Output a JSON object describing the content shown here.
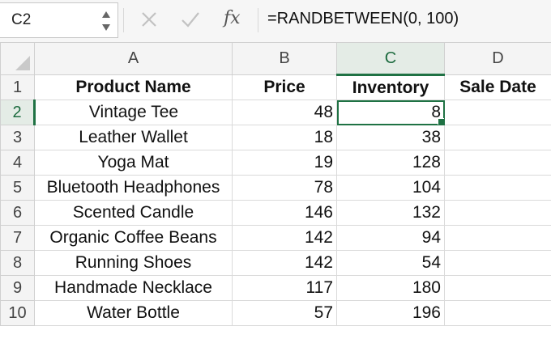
{
  "formula_bar": {
    "name_box": "C2",
    "formula": "=RANDBETWEEN(0, 100)",
    "icons": [
      "cancel-icon",
      "enter-check-icon",
      "fx-icon"
    ],
    "fx_label": "fx"
  },
  "columns": [
    "A",
    "B",
    "C",
    "D"
  ],
  "active_cell": "C2",
  "rows": [
    {
      "num": "1",
      "cells": [
        "Product Name",
        "Price",
        "Inventory",
        "Sale Date"
      ]
    },
    {
      "num": "2",
      "cells": [
        "Vintage Tee",
        "48",
        "8",
        ""
      ]
    },
    {
      "num": "3",
      "cells": [
        "Leather Wallet",
        "18",
        "38",
        ""
      ]
    },
    {
      "num": "4",
      "cells": [
        "Yoga Mat",
        "19",
        "128",
        ""
      ]
    },
    {
      "num": "5",
      "cells": [
        "Bluetooth Headphones",
        "78",
        "104",
        ""
      ]
    },
    {
      "num": "6",
      "cells": [
        "Scented Candle",
        "146",
        "132",
        ""
      ]
    },
    {
      "num": "7",
      "cells": [
        "Organic Coffee Beans",
        "142",
        "94",
        ""
      ]
    },
    {
      "num": "8",
      "cells": [
        "Running Shoes",
        "142",
        "54",
        ""
      ]
    },
    {
      "num": "9",
      "cells": [
        "Handmade Necklace",
        "117",
        "180",
        ""
      ]
    },
    {
      "num": "10",
      "cells": [
        "Water Bottle",
        "57",
        "196",
        ""
      ]
    }
  ],
  "colors": {
    "accent": "#1f7244",
    "header_bg": "#f4f4f4",
    "active_header_bg": "#e4ece6"
  }
}
